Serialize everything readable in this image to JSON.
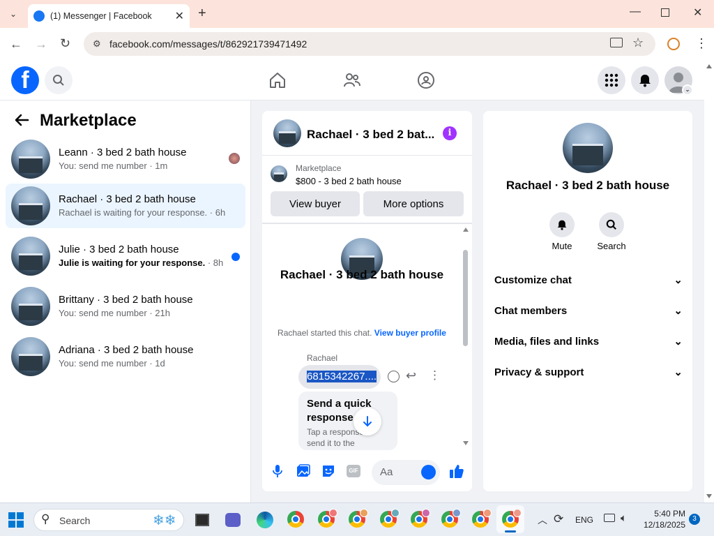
{
  "browser": {
    "tab_title": "(1) Messenger | Facebook",
    "url": "facebook.com/messages/t/862921739471492"
  },
  "left": {
    "title": "Marketplace",
    "conversations": [
      {
        "name": "Leann · 3 bed 2 bath house",
        "preview": "You: send me number · 1m"
      },
      {
        "name": "Rachael · 3 bed 2 bath house",
        "preview": "Rachael is waiting for your response. · 6h"
      },
      {
        "name": "Julie · 3 bed 2 bath house",
        "preview": "Julie is waiting for your response.",
        "time": " · 8h"
      },
      {
        "name": "Brittany · 3 bed 2 bath house",
        "preview": "You: send me number · 21h"
      },
      {
        "name": "Adriana · 3 bed 2 bath house",
        "preview": "You: send me number · 1d"
      }
    ]
  },
  "chat": {
    "header_title": "Rachael · 3 bed 2 bat...",
    "listing_source": "Marketplace",
    "listing_title": "$800 - 3 bed 2 bath house",
    "view_buyer": "View buyer",
    "more_options": "More options",
    "profile_name": "Rachael · 3 bed 2 bath house",
    "started_text": "Rachael started this chat.",
    "view_profile": "View buyer profile",
    "sender": "Rachael",
    "message": "6815342267....",
    "quick_title": "Send a quick response",
    "quick_sub": "Tap a response to send it to the",
    "composer_placeholder": "Aa",
    "gif_label": "GIF"
  },
  "details": {
    "name": "Rachael · 3 bed 2 bath house",
    "mute": "Mute",
    "search": "Search",
    "sections": [
      "Customize chat",
      "Chat members",
      "Media, files and links",
      "Privacy & support"
    ]
  },
  "taskbar": {
    "search_placeholder": "Search",
    "lang": "ENG",
    "time": "5:40 PM",
    "date": "12/18/2025",
    "notif_count": "3"
  },
  "colors": {
    "accent": "#0866ff",
    "messenger_purple": "#a033ff",
    "selected": "#ebf5ff"
  }
}
